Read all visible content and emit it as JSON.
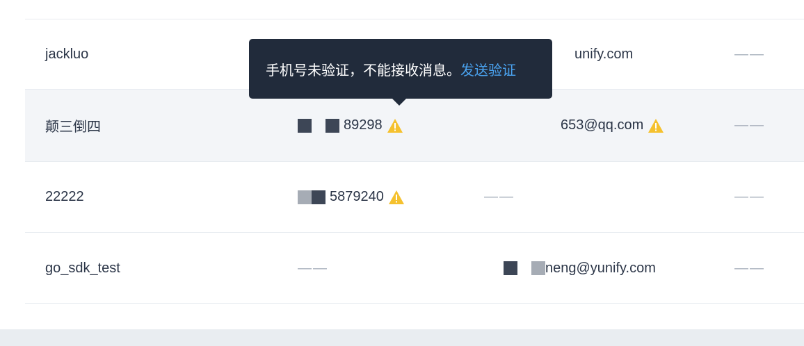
{
  "empty_placeholder": "——",
  "rows": [
    {
      "name": "jackluo",
      "phone": "",
      "email": "unify.com",
      "other": "——"
    },
    {
      "name": "颠三倒四",
      "phone": "89298",
      "email": "653@qq.com",
      "other": "——"
    },
    {
      "name": "22222",
      "phone": "5879240",
      "email": "——",
      "other": "——"
    },
    {
      "name": "go_sdk_test",
      "phone": "——",
      "email": "neng@yunify.com",
      "other": "——"
    }
  ],
  "tooltip": {
    "message": "手机号未验证，不能接收消息。",
    "action_label": "发送验证"
  },
  "colors": {
    "warning": "#f5c12e",
    "link": "#4aa3f0",
    "tooltip_bg": "#212b3b"
  }
}
